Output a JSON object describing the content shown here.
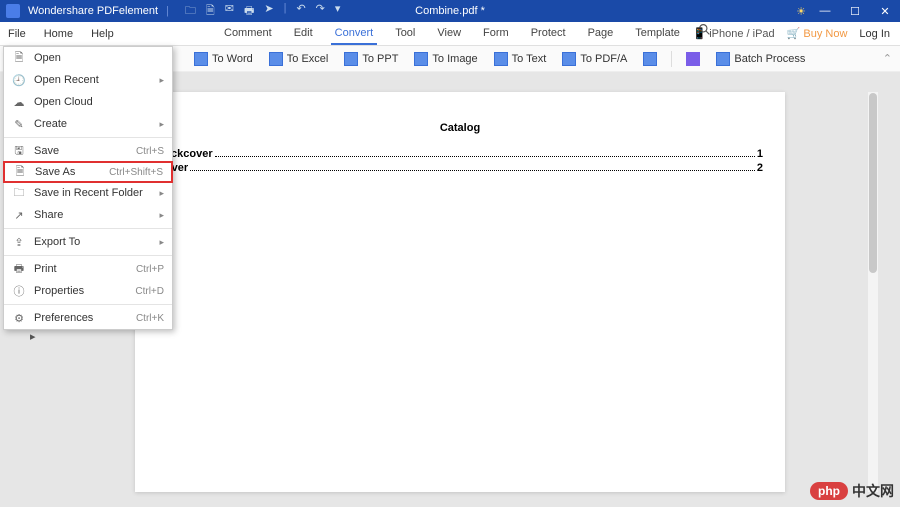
{
  "titlebar": {
    "app_name": "Wondershare PDFelement",
    "doc_name": "Combine.pdf *"
  },
  "menubar": {
    "left": [
      "File",
      "Home",
      "Help"
    ],
    "tabs": [
      "Comment",
      "Edit",
      "Convert",
      "Tool",
      "View",
      "Form",
      "Protect",
      "Page",
      "Template"
    ],
    "active_tab": "Convert",
    "device": "iPhone / iPad",
    "buy": "Buy Now",
    "login": "Log In"
  },
  "toolbar": {
    "items": [
      "To Word",
      "To Excel",
      "To PPT",
      "To Image",
      "To Text",
      "To PDF/A"
    ],
    "batch": "Batch Process"
  },
  "file_menu": [
    {
      "icon": "open",
      "label": "Open",
      "shortcut": "",
      "sub": false
    },
    {
      "icon": "recent",
      "label": "Open Recent",
      "shortcut": "",
      "sub": true
    },
    {
      "icon": "cloud",
      "label": "Open Cloud",
      "shortcut": "",
      "sub": false
    },
    {
      "icon": "create",
      "label": "Create",
      "shortcut": "",
      "sub": true
    },
    {
      "sep": true
    },
    {
      "icon": "save",
      "label": "Save",
      "shortcut": "Ctrl+S",
      "sub": false
    },
    {
      "icon": "saveas",
      "label": "Save As",
      "shortcut": "Ctrl+Shift+S",
      "sub": false,
      "highlight": true
    },
    {
      "icon": "recentf",
      "label": "Save in Recent Folder",
      "shortcut": "",
      "sub": true
    },
    {
      "icon": "share",
      "label": "Share",
      "shortcut": "",
      "sub": true
    },
    {
      "sep": true
    },
    {
      "icon": "export",
      "label": "Export To",
      "shortcut": "",
      "sub": true
    },
    {
      "sep": true
    },
    {
      "icon": "print",
      "label": "Print",
      "shortcut": "Ctrl+P",
      "sub": false
    },
    {
      "icon": "props",
      "label": "Properties",
      "shortcut": "Ctrl+D",
      "sub": false
    },
    {
      "sep": true
    },
    {
      "icon": "prefs",
      "label": "Preferences",
      "shortcut": "Ctrl+K",
      "sub": false
    }
  ],
  "document": {
    "title": "Catalog",
    "toc": [
      {
        "label": "Backcover",
        "page": "1"
      },
      {
        "label": "Cover",
        "page": "2"
      }
    ]
  },
  "watermark": {
    "badge": "php",
    "text": "中文网"
  }
}
